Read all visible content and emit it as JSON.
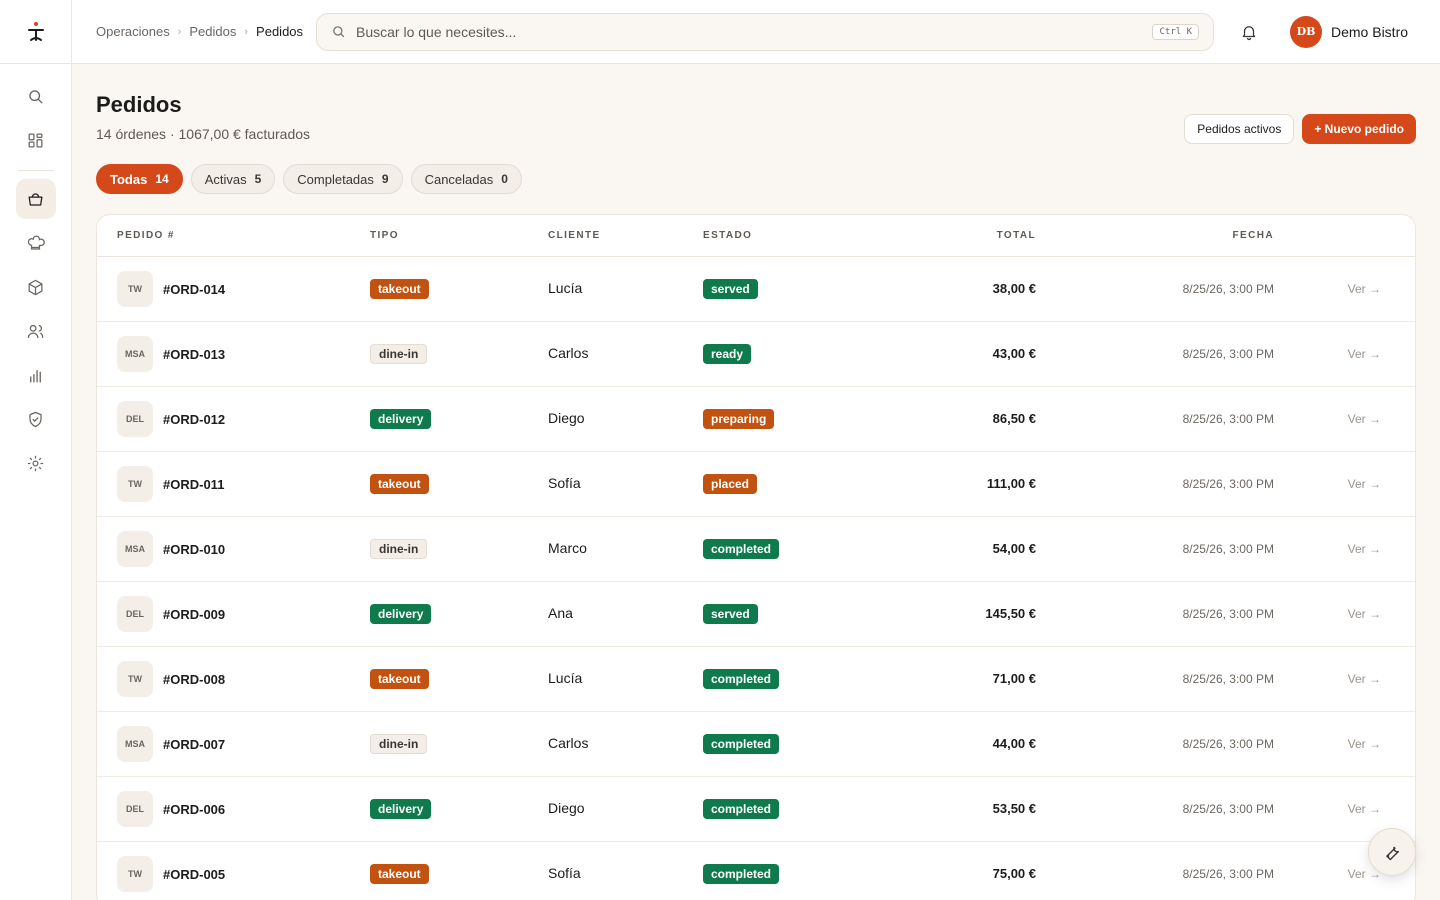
{
  "breadcrumb": [
    "Operaciones",
    "Pedidos",
    "Pedidos"
  ],
  "search": {
    "placeholder": "Buscar lo que necesites...",
    "shortcut": "Ctrl K"
  },
  "user": {
    "initials": "DB",
    "name": "Demo Bistro"
  },
  "sidebar": {
    "items": [
      {
        "icon": "search-icon"
      },
      {
        "icon": "dashboard-icon"
      },
      {
        "icon": "basket-icon",
        "active": true
      },
      {
        "icon": "chef-hat-icon"
      },
      {
        "icon": "box-icon"
      },
      {
        "icon": "users-icon"
      },
      {
        "icon": "bar-chart-icon"
      },
      {
        "icon": "shield-icon"
      },
      {
        "icon": "settings-sun-icon"
      }
    ]
  },
  "page": {
    "title": "Pedidos",
    "subtitle": "14 órdenes · 1067,00 € facturados",
    "btn_active": "Pedidos activos",
    "btn_new": "+ Nuevo pedido"
  },
  "filters": [
    {
      "label": "Todas",
      "count": "14",
      "active": true
    },
    {
      "label": "Activas",
      "count": "5"
    },
    {
      "label": "Completadas",
      "count": "9"
    },
    {
      "label": "Canceladas",
      "count": "0"
    }
  ],
  "columns": {
    "id": "PEDIDO #",
    "tipo": "TIPO",
    "cliente": "CLIENTE",
    "estado": "ESTADO",
    "total": "TOTAL",
    "fecha": "FECHA"
  },
  "orders": [
    {
      "src": "TW",
      "id": "#ORD-014",
      "tipo": "takeout",
      "cliente": "Lucía",
      "estado": "served",
      "total": "38,00 €",
      "fecha": "8/25/26, 3:00 PM",
      "ver": "Ver →"
    },
    {
      "src": "MSA",
      "id": "#ORD-013",
      "tipo": "dine-in",
      "cliente": "Carlos",
      "estado": "ready",
      "total": "43,00 €",
      "fecha": "8/25/26, 3:00 PM",
      "ver": "Ver →"
    },
    {
      "src": "DEL",
      "id": "#ORD-012",
      "tipo": "delivery",
      "cliente": "Diego",
      "estado": "preparing",
      "total": "86,50 €",
      "fecha": "8/25/26, 3:00 PM",
      "ver": "Ver →"
    },
    {
      "src": "TW",
      "id": "#ORD-011",
      "tipo": "takeout",
      "cliente": "Sofía",
      "estado": "placed",
      "total": "111,00 €",
      "fecha": "8/25/26, 3:00 PM",
      "ver": "Ver →"
    },
    {
      "src": "MSA",
      "id": "#ORD-010",
      "tipo": "dine-in",
      "cliente": "Marco",
      "estado": "completed",
      "total": "54,00 €",
      "fecha": "8/25/26, 3:00 PM",
      "ver": "Ver →"
    },
    {
      "src": "DEL",
      "id": "#ORD-009",
      "tipo": "delivery",
      "cliente": "Ana",
      "estado": "served",
      "total": "145,50 €",
      "fecha": "8/25/26, 3:00 PM",
      "ver": "Ver →"
    },
    {
      "src": "TW",
      "id": "#ORD-008",
      "tipo": "takeout",
      "cliente": "Lucía",
      "estado": "completed",
      "total": "71,00 €",
      "fecha": "8/25/26, 3:00 PM",
      "ver": "Ver →"
    },
    {
      "src": "MSA",
      "id": "#ORD-007",
      "tipo": "dine-in",
      "cliente": "Carlos",
      "estado": "completed",
      "total": "44,00 €",
      "fecha": "8/25/26, 3:00 PM",
      "ver": "Ver →"
    },
    {
      "src": "DEL",
      "id": "#ORD-006",
      "tipo": "delivery",
      "cliente": "Diego",
      "estado": "completed",
      "total": "53,50 €",
      "fecha": "8/25/26, 3:00 PM",
      "ver": "Ver →"
    },
    {
      "src": "TW",
      "id": "#ORD-005",
      "tipo": "takeout",
      "cliente": "Sofía",
      "estado": "completed",
      "total": "75,00 €",
      "fecha": "8/25/26, 3:00 PM",
      "ver": "Ver →"
    }
  ],
  "colors": {
    "accent": "#d4481a",
    "success": "#0f7a4c",
    "warning": "#c2520f"
  }
}
